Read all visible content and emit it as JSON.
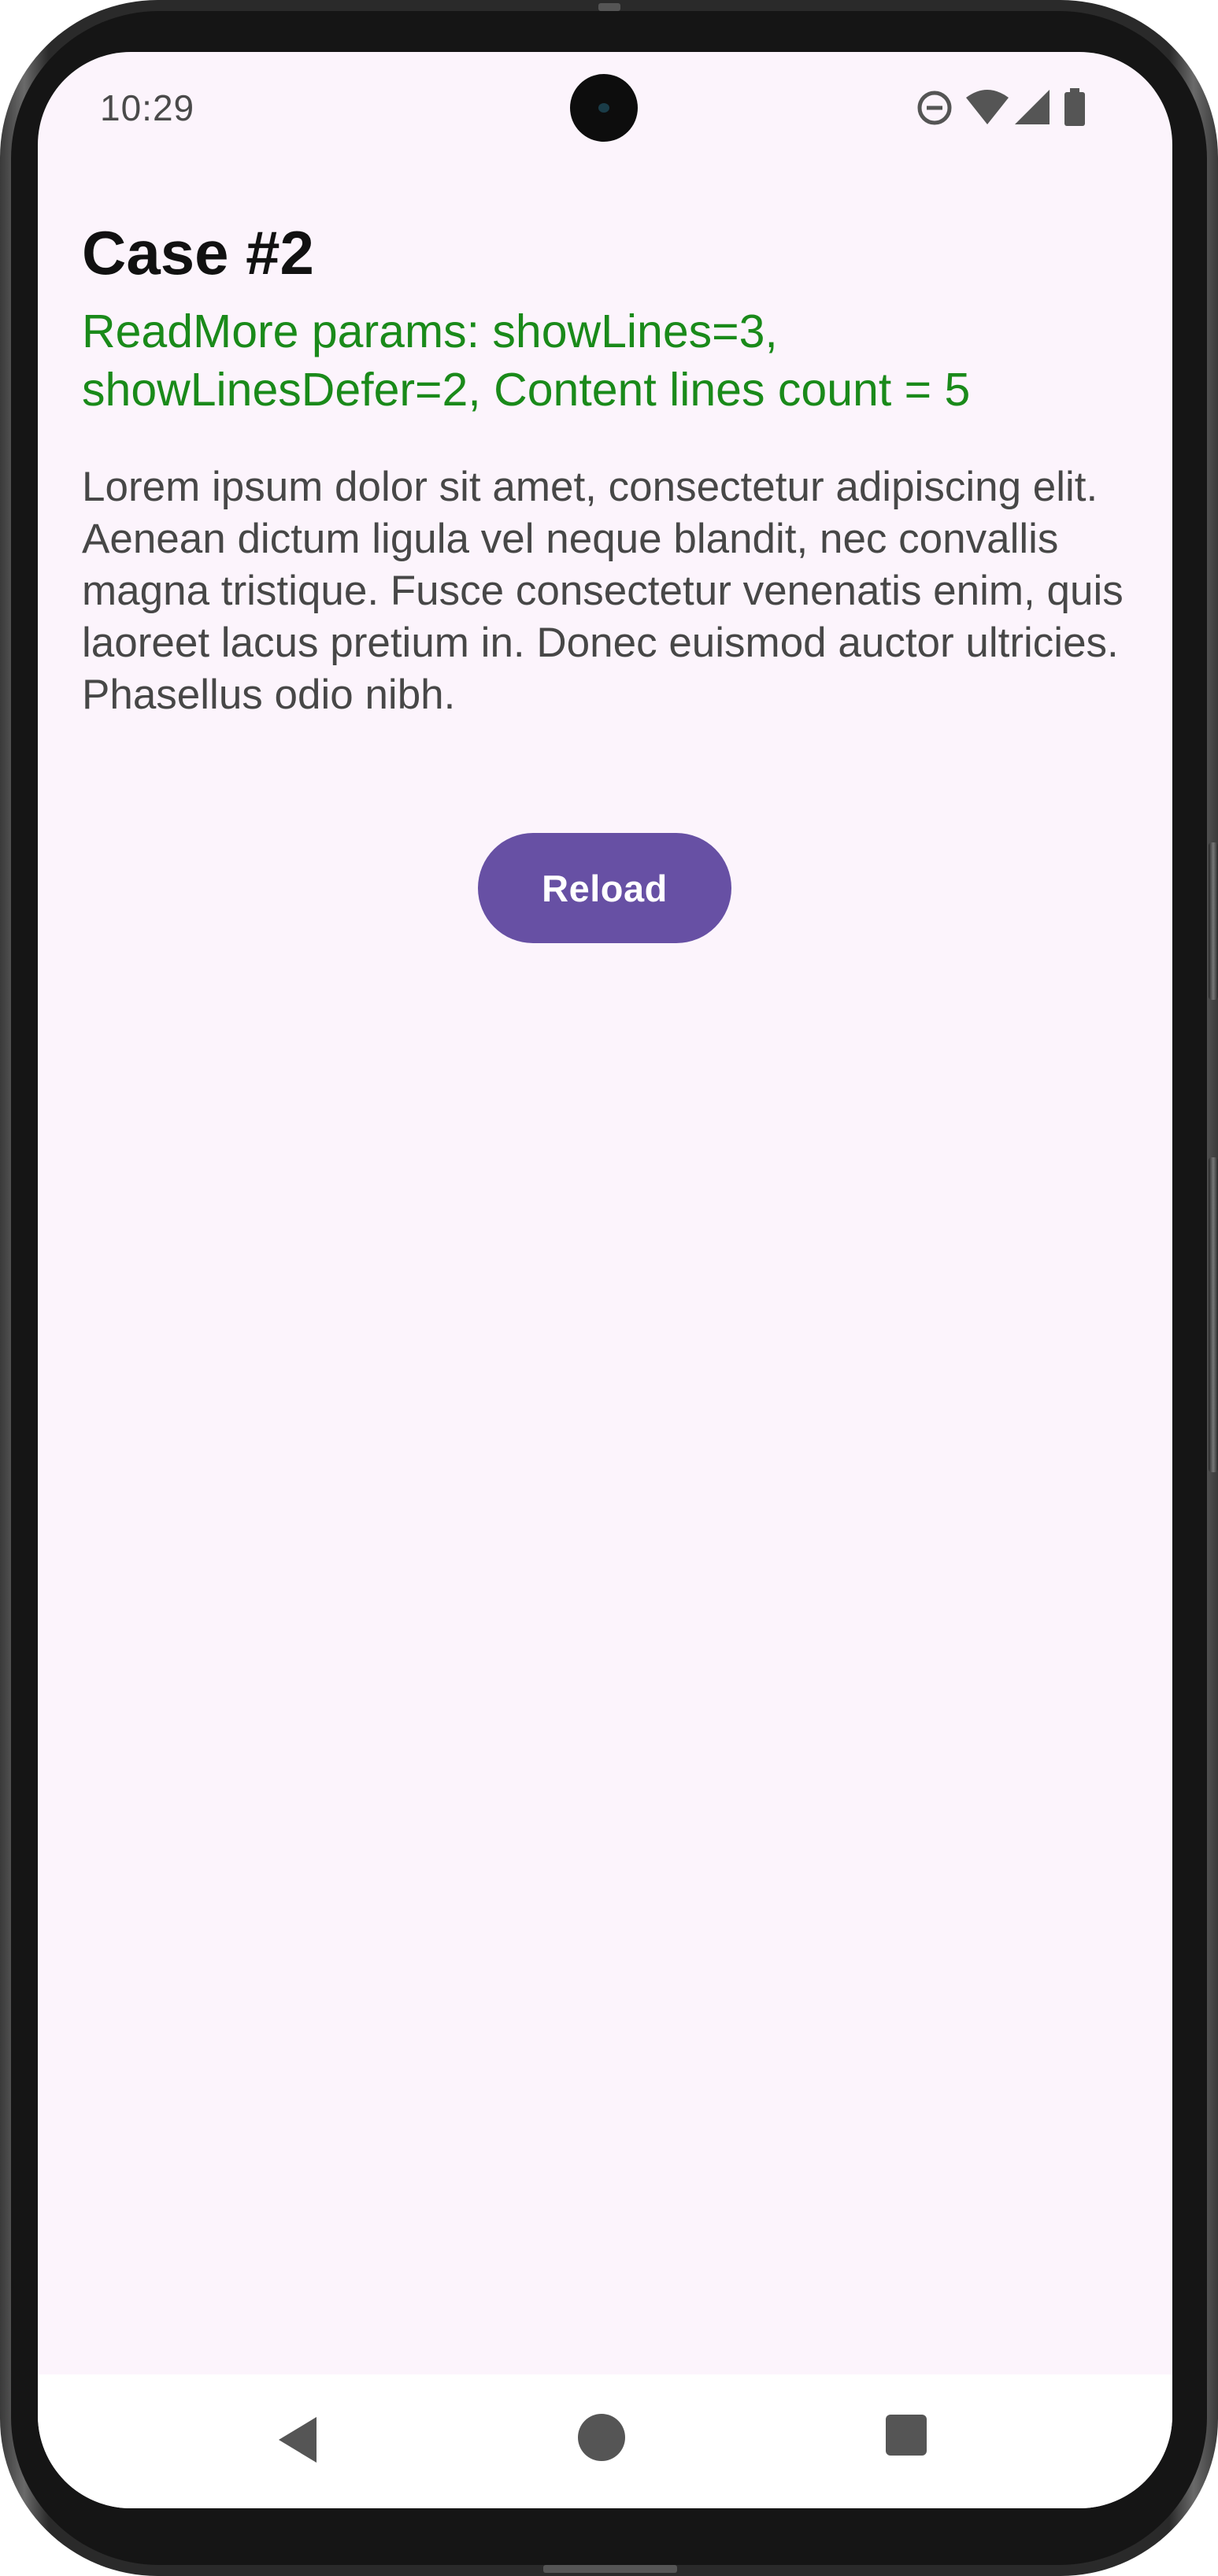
{
  "status_bar": {
    "time": "10:29",
    "icons": [
      "do-not-disturb-icon",
      "wifi-icon",
      "cellular-signal-icon",
      "battery-icon"
    ]
  },
  "content": {
    "title": "Case #2",
    "params": "ReadMore params: showLines=3, showLinesDefer=2, Content lines count = 5",
    "body": "Lorem ipsum dolor sit amet, consectetur adipiscing elit. Aenean dictum ligula vel neque blandit, nec convallis magna tristique. Fusce consectetur venenatis enim, quis laoreet lacus pretium in. Donec euismod auctor ultricies. Phasellus odio nibh."
  },
  "actions": {
    "reload_label": "Reload"
  },
  "nav_bar": {
    "buttons": [
      "back-icon",
      "home-icon",
      "recents-icon"
    ]
  },
  "colors": {
    "accent": "#6750a4",
    "params_text": "#1a8a1a",
    "background": "#fcf4fc"
  }
}
